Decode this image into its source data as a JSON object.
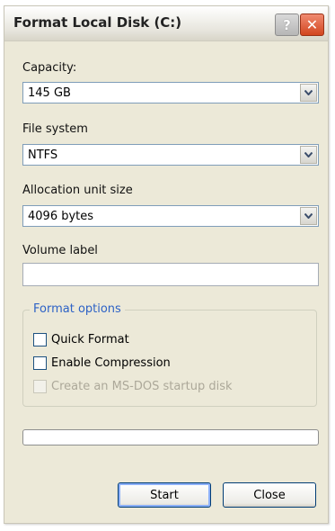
{
  "window": {
    "title": "Format Local Disk (C:)",
    "help_button": "?",
    "close_button": "✕"
  },
  "capacity": {
    "label": "Capacity:",
    "value": "145 GB"
  },
  "file_system": {
    "label": "File system",
    "value": "NTFS"
  },
  "allocation": {
    "label": "Allocation unit size",
    "value": "4096 bytes"
  },
  "volume_label": {
    "label": "Volume label",
    "value": ""
  },
  "format_options": {
    "title": "Format options",
    "quick_format": {
      "label": "Quick Format",
      "checked": false
    },
    "enable_compression": {
      "label": "Enable Compression",
      "checked": false
    },
    "msdos_startup": {
      "label": "Create an MS-DOS startup disk",
      "checked": false,
      "disabled": true
    }
  },
  "progress": {
    "fraction": 0
  },
  "buttons": {
    "start": "Start",
    "close": "Close"
  },
  "icons": {
    "dropdown": "chevron-down-icon",
    "help": "question-mark-icon",
    "close": "close-icon"
  },
  "colors": {
    "window_bg": "#ece9d8",
    "group_title": "#2d62c6",
    "close_button": "#d2451f"
  }
}
